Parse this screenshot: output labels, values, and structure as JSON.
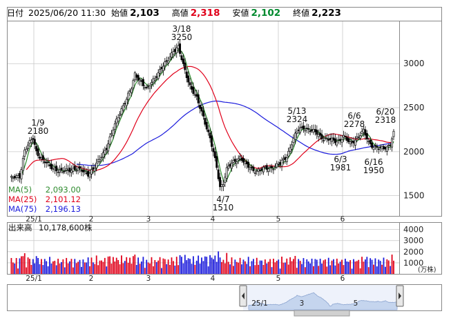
{
  "header": {
    "date_label": "日付",
    "datetime": "2025/06/20 11:30",
    "open_label": "始値",
    "open": "2,103",
    "high_label": "高値",
    "high": "2,318",
    "low_label": "安値",
    "low": "2,102",
    "close_label": "終値",
    "close": "2,223"
  },
  "ma_legend": [
    {
      "label": "MA(5)",
      "value": "2,093.00",
      "color": "#2e8b2e"
    },
    {
      "label": "MA(25)",
      "value": "2,101.12",
      "color": "#e0001a"
    },
    {
      "label": "MA(75)",
      "value": "2,196.13",
      "color": "#1a1adc"
    }
  ],
  "volume_legend": {
    "label": "出来高",
    "value": "10,178,600株"
  },
  "volume_unit": "(万株)",
  "colors": {
    "up": "#e0001a",
    "down": "#1a1adc",
    "ma5": "#2e8b2e",
    "ma25": "#e0001a",
    "ma75": "#1a1adc",
    "grid": "#c8c8c8",
    "navigator_fill": "#c5d5ee"
  },
  "chart_data": [
    {
      "type": "candlestick",
      "x_ticks": [
        "25/1",
        "2",
        "3",
        "4",
        "5",
        "6"
      ],
      "y_ticks": [
        1500,
        2000,
        2500,
        3000
      ],
      "ylim": [
        1270,
        3480
      ],
      "annotations": [
        {
          "date": "1/9",
          "value": "2180"
        },
        {
          "date": "3/18",
          "value": "3250"
        },
        {
          "date": "4/7",
          "value": "1510"
        },
        {
          "date": "5/13",
          "value": "2324"
        },
        {
          "date": "6/6",
          "value": "2278"
        },
        {
          "date": "6/3",
          "value": "1981"
        },
        {
          "date": "6/16",
          "value": "1950"
        },
        {
          "date": "6/20",
          "value": "2318"
        }
      ]
    },
    {
      "type": "bar",
      "title": "出来高",
      "y_ticks": [
        1000,
        2000,
        3000,
        4000
      ],
      "ylim": [
        0,
        4600
      ],
      "unit": "(万株)"
    }
  ],
  "navigator": {
    "labels": [
      "25/1",
      "3",
      "5"
    ]
  }
}
